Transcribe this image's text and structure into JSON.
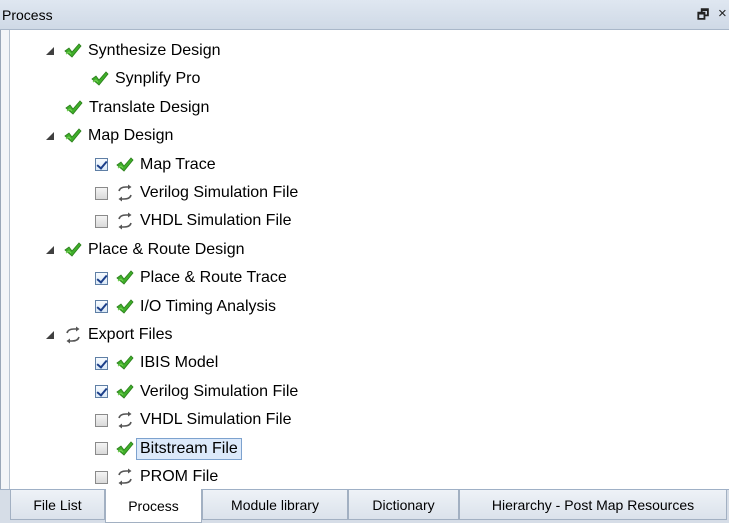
{
  "panel": {
    "title": "Process",
    "float_glyph": "🗗",
    "close_glyph": "×"
  },
  "tree": [
    {
      "label": "Synthesize Design",
      "level": 0,
      "arrow": "expanded",
      "checkbox": "none",
      "status": "done",
      "selected": false
    },
    {
      "label": "Synplify Pro",
      "level": 1,
      "arrow": "none",
      "checkbox": "none",
      "status": "done",
      "selected": false
    },
    {
      "label": "Translate Design",
      "level": 0,
      "arrow": "none",
      "checkbox": "none",
      "status": "done",
      "selected": false
    },
    {
      "label": "Map Design",
      "level": 0,
      "arrow": "expanded",
      "checkbox": "none",
      "status": "done",
      "selected": false
    },
    {
      "label": "Map Trace",
      "level": 1,
      "arrow": "none",
      "checkbox": "checked",
      "status": "done",
      "selected": false
    },
    {
      "label": "Verilog Simulation File",
      "level": 1,
      "arrow": "none",
      "checkbox": "unchecked",
      "status": "pending",
      "selected": false
    },
    {
      "label": "VHDL Simulation File",
      "level": 1,
      "arrow": "none",
      "checkbox": "unchecked",
      "status": "pending",
      "selected": false
    },
    {
      "label": "Place & Route Design",
      "level": 0,
      "arrow": "expanded",
      "checkbox": "none",
      "status": "done",
      "selected": false
    },
    {
      "label": "Place & Route Trace",
      "level": 1,
      "arrow": "none",
      "checkbox": "checked",
      "status": "done",
      "selected": false
    },
    {
      "label": "I/O Timing Analysis",
      "level": 1,
      "arrow": "none",
      "checkbox": "checked",
      "status": "done",
      "selected": false
    },
    {
      "label": "Export Files",
      "level": 0,
      "arrow": "expanded",
      "checkbox": "none",
      "status": "pending",
      "selected": false
    },
    {
      "label": "IBIS Model",
      "level": 1,
      "arrow": "none",
      "checkbox": "checked",
      "status": "done",
      "selected": false
    },
    {
      "label": "Verilog Simulation File",
      "level": 1,
      "arrow": "none",
      "checkbox": "checked",
      "status": "done",
      "selected": false
    },
    {
      "label": "VHDL Simulation File",
      "level": 1,
      "arrow": "none",
      "checkbox": "unchecked",
      "status": "pending",
      "selected": false
    },
    {
      "label": "Bitstream File",
      "level": 1,
      "arrow": "none",
      "checkbox": "unchecked",
      "status": "done",
      "selected": true
    },
    {
      "label": "PROM File",
      "level": 1,
      "arrow": "none",
      "checkbox": "unchecked",
      "status": "pending",
      "selected": false
    }
  ],
  "tabs": [
    {
      "label": "File List",
      "active": false
    },
    {
      "label": "Process",
      "active": true
    },
    {
      "label": "Module library",
      "active": false
    },
    {
      "label": "Dictionary",
      "active": false
    },
    {
      "label": "Hierarchy - Post Map Resources",
      "active": false
    }
  ],
  "icons": {
    "done": "green-check-icon",
    "pending": "refresh-arrows-icon",
    "expanded": "expanded-triangle-icon"
  },
  "colors": {
    "done_green": "#3fae2a",
    "done_dark": "#2a7d1a",
    "pending_gray": "#555555",
    "selection_bg": "#dce9fa"
  }
}
